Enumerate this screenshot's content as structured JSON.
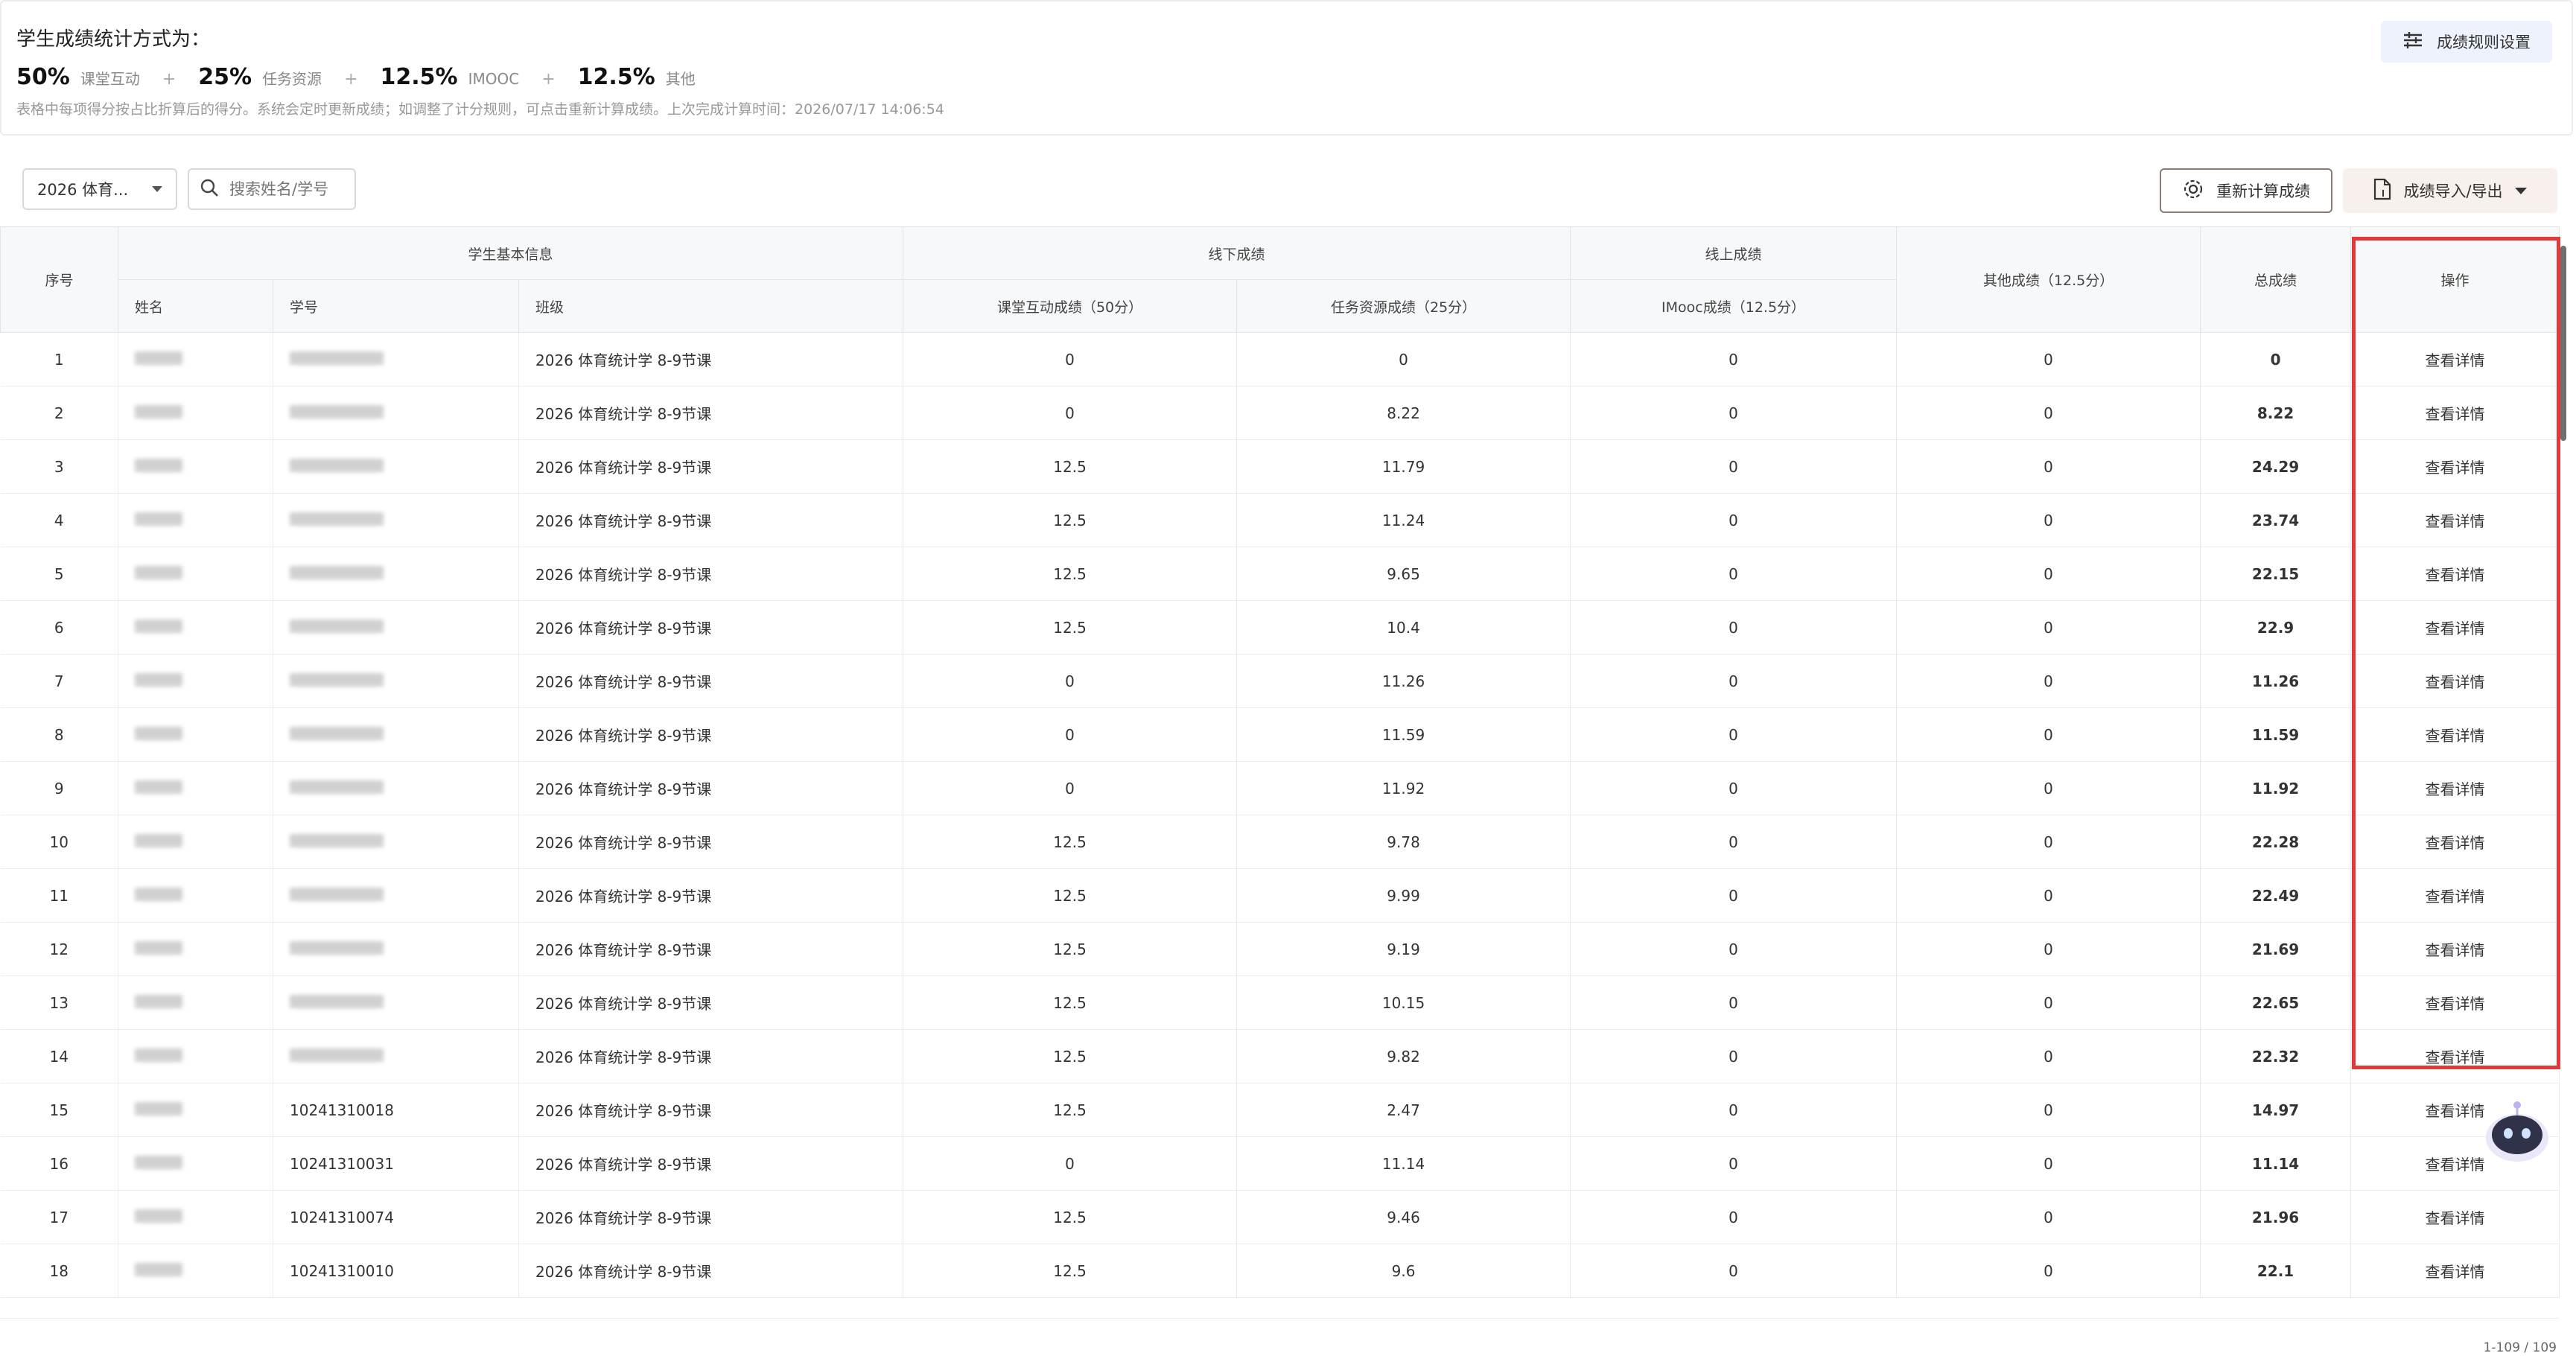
{
  "header": {
    "title": "学生成绩统计方式为：",
    "formula": [
      {
        "pct": "50%",
        "label": "课堂互动"
      },
      {
        "pct": "25%",
        "label": "任务资源"
      },
      {
        "pct": "12.5%",
        "label": "IMOOC"
      },
      {
        "pct": "12.5%",
        "label": "其他"
      }
    ],
    "plus": "+",
    "note": "表格中每项得分按占比折算后的得分。系统会定时更新成绩；如调整了计分规则，可点击重新计算成绩。上次完成计算时间：2026/07/17 14:06:54",
    "rule_button": "成绩规则设置"
  },
  "toolbar": {
    "class_select": "2026 体育...",
    "search_placeholder": "搜索姓名/学号",
    "recalc_button": "重新计算成绩",
    "import_export_button": "成绩导入/导出"
  },
  "table": {
    "group_headers": {
      "index": "序号",
      "basic": "学生基本信息",
      "offline": "线下成绩",
      "online": "线上成绩",
      "other": "其他成绩（12.5分）",
      "total": "总成绩",
      "action": "操作"
    },
    "sub_headers": {
      "name": "姓名",
      "id": "学号",
      "class": "班级",
      "interaction": "课堂互动成绩（50分）",
      "task": "任务资源成绩（25分）",
      "imooc": "IMooc成绩（12.5分）"
    },
    "rows": [
      {
        "no": "1",
        "id": "",
        "cls": "2026 体育统计学 8-9节课",
        "inter": "0",
        "task": "0",
        "imooc": "0",
        "other": "0",
        "total": "0",
        "op": "查看详情"
      },
      {
        "no": "2",
        "id": "",
        "cls": "2026 体育统计学 8-9节课",
        "inter": "0",
        "task": "8.22",
        "imooc": "0",
        "other": "0",
        "total": "8.22",
        "op": "查看详情"
      },
      {
        "no": "3",
        "id": "",
        "cls": "2026 体育统计学 8-9节课",
        "inter": "12.5",
        "task": "11.79",
        "imooc": "0",
        "other": "0",
        "total": "24.29",
        "op": "查看详情"
      },
      {
        "no": "4",
        "id": "",
        "cls": "2026 体育统计学 8-9节课",
        "inter": "12.5",
        "task": "11.24",
        "imooc": "0",
        "other": "0",
        "total": "23.74",
        "op": "查看详情"
      },
      {
        "no": "5",
        "id": "",
        "cls": "2026 体育统计学 8-9节课",
        "inter": "12.5",
        "task": "9.65",
        "imooc": "0",
        "other": "0",
        "total": "22.15",
        "op": "查看详情"
      },
      {
        "no": "6",
        "id": "",
        "cls": "2026 体育统计学 8-9节课",
        "inter": "12.5",
        "task": "10.4",
        "imooc": "0",
        "other": "0",
        "total": "22.9",
        "op": "查看详情"
      },
      {
        "no": "7",
        "id": "",
        "cls": "2026 体育统计学 8-9节课",
        "inter": "0",
        "task": "11.26",
        "imooc": "0",
        "other": "0",
        "total": "11.26",
        "op": "查看详情"
      },
      {
        "no": "8",
        "id": "",
        "cls": "2026 体育统计学 8-9节课",
        "inter": "0",
        "task": "11.59",
        "imooc": "0",
        "other": "0",
        "total": "11.59",
        "op": "查看详情"
      },
      {
        "no": "9",
        "id": "",
        "cls": "2026 体育统计学 8-9节课",
        "inter": "0",
        "task": "11.92",
        "imooc": "0",
        "other": "0",
        "total": "11.92",
        "op": "查看详情"
      },
      {
        "no": "10",
        "id": "",
        "cls": "2026 体育统计学 8-9节课",
        "inter": "12.5",
        "task": "9.78",
        "imooc": "0",
        "other": "0",
        "total": "22.28",
        "op": "查看详情"
      },
      {
        "no": "11",
        "id": "",
        "cls": "2026 体育统计学 8-9节课",
        "inter": "12.5",
        "task": "9.99",
        "imooc": "0",
        "other": "0",
        "total": "22.49",
        "op": "查看详情"
      },
      {
        "no": "12",
        "id": "",
        "cls": "2026 体育统计学 8-9节课",
        "inter": "12.5",
        "task": "9.19",
        "imooc": "0",
        "other": "0",
        "total": "21.69",
        "op": "查看详情"
      },
      {
        "no": "13",
        "id": "",
        "cls": "2026 体育统计学 8-9节课",
        "inter": "12.5",
        "task": "10.15",
        "imooc": "0",
        "other": "0",
        "total": "22.65",
        "op": "查看详情"
      },
      {
        "no": "14",
        "id": "",
        "cls": "2026 体育统计学 8-9节课",
        "inter": "12.5",
        "task": "9.82",
        "imooc": "0",
        "other": "0",
        "total": "22.32",
        "op": "查看详情"
      },
      {
        "no": "15",
        "id": "10241310018",
        "cls": "2026 体育统计学 8-9节课",
        "inter": "12.5",
        "task": "2.47",
        "imooc": "0",
        "other": "0",
        "total": "14.97",
        "op": "查看详情"
      },
      {
        "no": "16",
        "id": "10241310031",
        "cls": "2026 体育统计学 8-9节课",
        "inter": "0",
        "task": "11.14",
        "imooc": "0",
        "other": "0",
        "total": "11.14",
        "op": "查看详情"
      },
      {
        "no": "17",
        "id": "10241310074",
        "cls": "2026 体育统计学 8-9节课",
        "inter": "12.5",
        "task": "9.46",
        "imooc": "0",
        "other": "0",
        "total": "21.96",
        "op": "查看详情"
      },
      {
        "no": "18",
        "id": "10241310010",
        "cls": "2026 体育统计学 8-9节课",
        "inter": "12.5",
        "task": "9.6",
        "imooc": "0",
        "other": "0",
        "total": "22.1",
        "op": "查看详情"
      }
    ]
  },
  "pagination": "1-109 / 109",
  "colors": {
    "highlight": "#e03a3a",
    "header_bg": "#f7f8fa",
    "rule_btn_bg": "#eef3fb",
    "export_btn_bg": "#f8f0ec"
  }
}
